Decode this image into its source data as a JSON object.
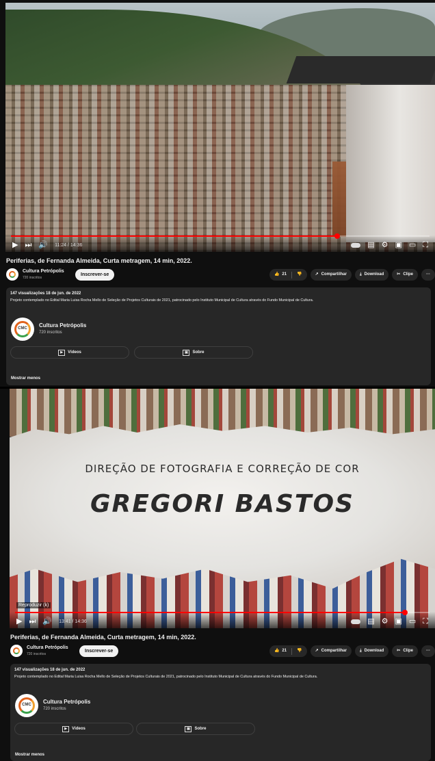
{
  "screens": [
    {
      "time": "11:24 / 14:36",
      "progress": 0.78
    },
    {
      "time": "13:41 / 14:36",
      "progress": 0.94,
      "credit_role": "DIREÇÃO DE FOTOGRAFIA E CORREÇÃO DE COR",
      "credit_name": "GREGORI BASTOS",
      "tooltip": "Reproduzir (k)"
    }
  ],
  "video": {
    "title": "Periferias, de Fernanda Almeida, Curta metragem, 14 min, 2022.",
    "channel": "Cultura Petrópolis",
    "subs_short": "720 inscritos",
    "subscribe_label": "Inscrever-se",
    "likes": "21",
    "share_label": "Compartilhar",
    "download_label": "Download",
    "clip_label": "Clipe",
    "more_label": "···"
  },
  "description": {
    "meta": "147 visualizações  18 de jun. de 2022",
    "text": "Projeto contemplado no Edital Maria Luisa Rocha Mello de Seleção de Projetos Culturais de 2021, patrocinado pelo Instituto Municipal de Cultura através do Fundo Municipal de Cultura.",
    "channel_name": "Cultura Petrópolis",
    "channel_subs": "720 inscritos",
    "logo_text": "CMC",
    "videos_label": "Vídeos",
    "about_label": "Sobre",
    "show_less": "Mostrar menos"
  },
  "icons": {
    "play": "▶",
    "next": "⏭",
    "volume": "🔊",
    "settings": "⚙",
    "miniplayer": "▣",
    "theater": "▭",
    "fullscreen": "⛶",
    "captions": "▤",
    "like": "👍",
    "dislike": "👎",
    "share": "↗",
    "download": "⤓",
    "clip": "✂",
    "videos": "▶",
    "about": "▣"
  },
  "colors": {
    "accent": "#ff0000",
    "bg": "#0f0f0f",
    "chip": "#272727"
  }
}
